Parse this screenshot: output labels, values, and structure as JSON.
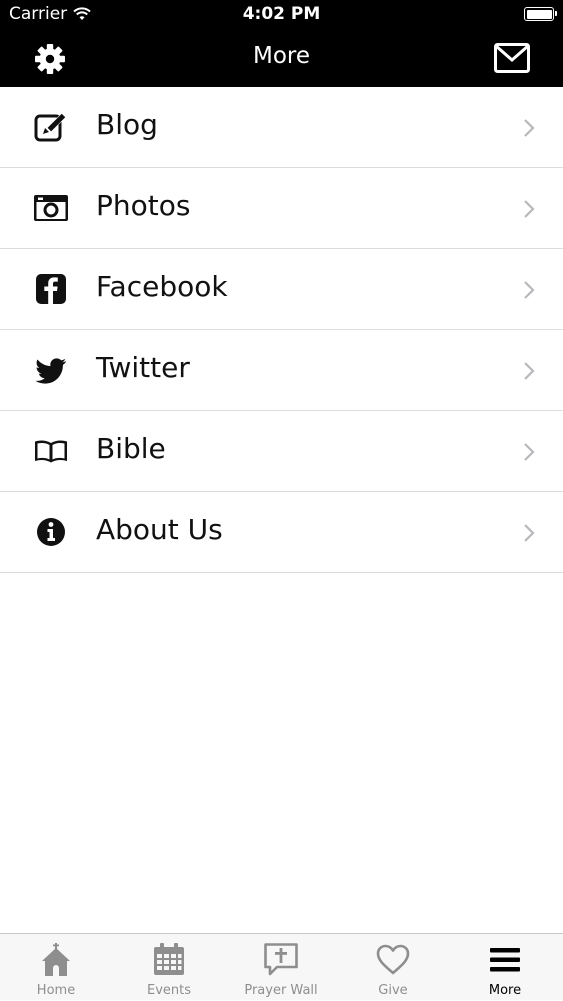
{
  "status_bar": {
    "carrier": "Carrier",
    "time": "4:02 PM"
  },
  "nav": {
    "title": "More"
  },
  "menu": [
    {
      "label": "Blog",
      "icon": "edit-icon"
    },
    {
      "label": "Photos",
      "icon": "camera-icon"
    },
    {
      "label": "Facebook",
      "icon": "facebook-icon"
    },
    {
      "label": "Twitter",
      "icon": "twitter-icon"
    },
    {
      "label": "Bible",
      "icon": "book-icon"
    },
    {
      "label": "About Us",
      "icon": "info-icon"
    }
  ],
  "tabs": [
    {
      "label": "Home",
      "icon": "church-icon"
    },
    {
      "label": "Events",
      "icon": "calendar-icon"
    },
    {
      "label": "Prayer Wall",
      "icon": "prayer-bubble-icon"
    },
    {
      "label": "Give",
      "icon": "heart-icon"
    },
    {
      "label": "More",
      "icon": "menu-icon",
      "active": true
    }
  ],
  "colors": {
    "bar": "#000000",
    "tab_inactive": "#8e8e8e",
    "divider": "#dcdcdc"
  }
}
